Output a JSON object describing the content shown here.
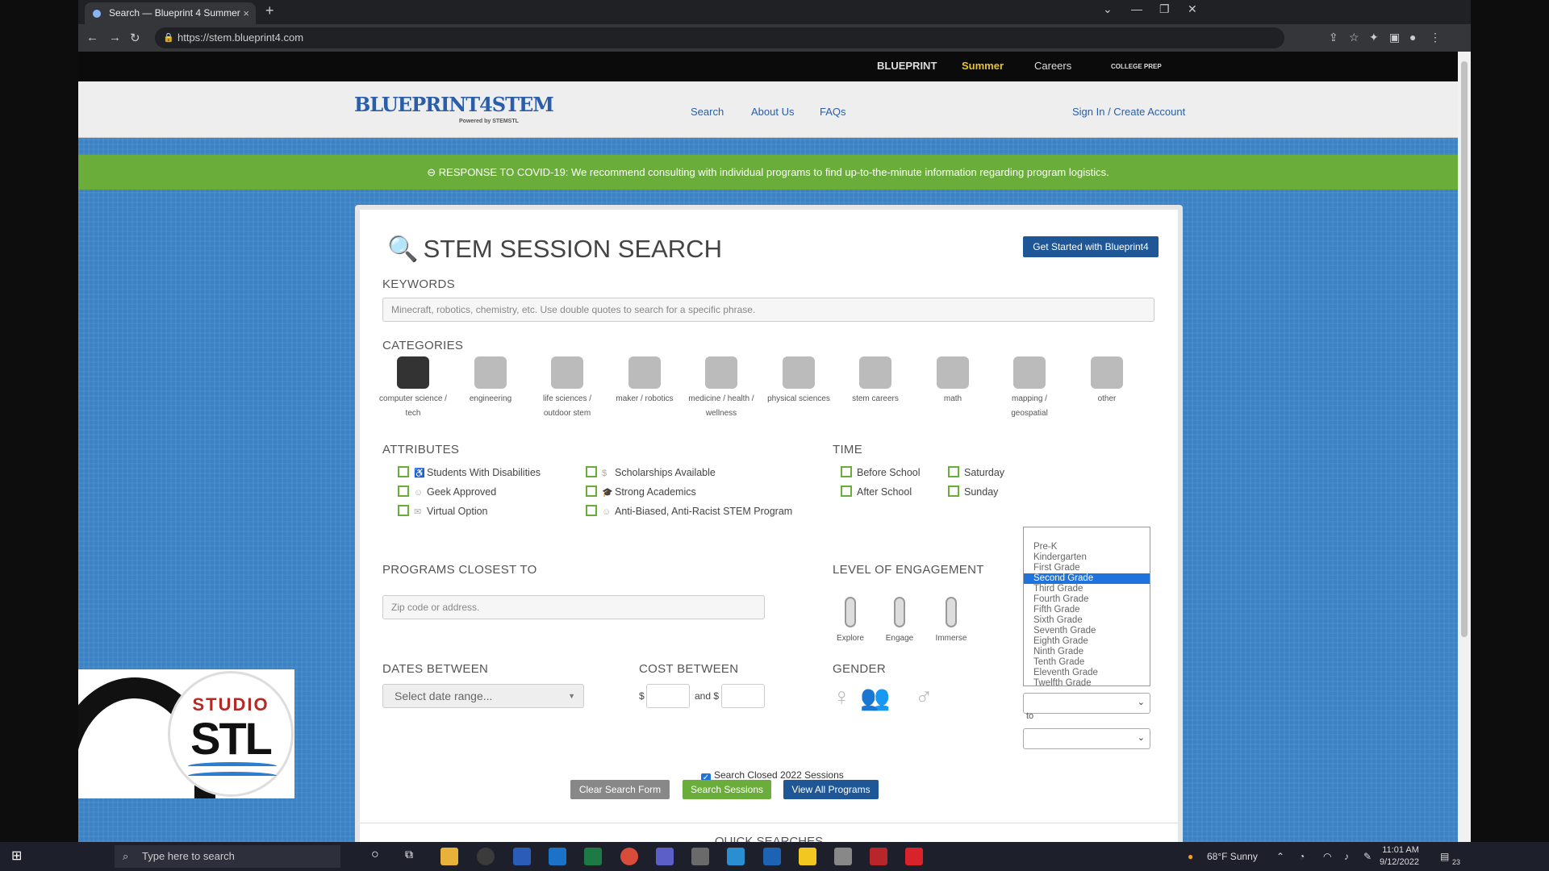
{
  "browser": {
    "tab_title": "Search — Blueprint 4 Summer",
    "url": "https://stem.blueprint4.com",
    "new_tab": "+",
    "close_tab": "×"
  },
  "topstrip": {
    "items": [
      "BLUEPRINT",
      "Summer",
      "Careers",
      "COLLEGE PREP"
    ]
  },
  "header": {
    "logo": "BLUEPRINT4STEM",
    "logo_sub": "Powered by STEMSTL",
    "nav": [
      "Search",
      "About Us",
      "FAQs"
    ],
    "signin": "Sign In / Create Account"
  },
  "banner": {
    "text": "RESPONSE TO COVID-19: We recommend consulting with individual programs to find up-to-the-minute information regarding program logistics."
  },
  "search": {
    "title": "STEM SESSION SEARCH",
    "get_started": "Get Started with Blueprint4",
    "keywords_label": "KEYWORDS",
    "keywords_placeholder": "Minecraft, robotics, chemistry, etc. Use double quotes to search for a specific phrase.",
    "categories_label": "CATEGORIES",
    "categories": [
      {
        "line1": "computer science /",
        "line2": "tech"
      },
      {
        "line1": "engineering",
        "line2": ""
      },
      {
        "line1": "life sciences /",
        "line2": "outdoor stem"
      },
      {
        "line1": "maker / robotics",
        "line2": ""
      },
      {
        "line1": "medicine / health /",
        "line2": "wellness"
      },
      {
        "line1": "physical sciences",
        "line2": ""
      },
      {
        "line1": "stem careers",
        "line2": ""
      },
      {
        "line1": "math",
        "line2": ""
      },
      {
        "line1": "mapping / geospatial",
        "line2": ""
      },
      {
        "line1": "other",
        "line2": ""
      }
    ],
    "attributes_label": "ATTRIBUTES",
    "attributes": [
      "Students With Disabilities",
      "Geek Approved",
      "Virtual Option",
      "Scholarships Available",
      "Strong Academics",
      "Anti-Biased, Anti-Racist STEM Program"
    ],
    "time_label": "TIME",
    "time": [
      "Before School",
      "After School",
      "Saturday",
      "Sunday"
    ],
    "closest_label": "PROGRAMS CLOSEST TO",
    "zip_placeholder": "Zip code or address.",
    "engagement_label": "LEVEL OF ENGAGEMENT",
    "engagement": [
      "Explore",
      "Engage",
      "Immerse"
    ],
    "dates_label": "DATES BETWEEN",
    "date_placeholder": "Select date range...",
    "cost_label": "COST BETWEEN",
    "cost_dollar": "$",
    "cost_and": "and $",
    "gender_label": "GENDER",
    "grade_to": "to",
    "grades": [
      "Pre-K",
      "Kindergarten",
      "First Grade",
      "Second Grade",
      "Third Grade",
      "Fourth Grade",
      "Fifth Grade",
      "Sixth Grade",
      "Seventh Grade",
      "Eighth Grade",
      "Ninth Grade",
      "Tenth Grade",
      "Eleventh Grade",
      "Twelfth Grade"
    ],
    "grade_selected": "Second Grade",
    "closed_label": "Search Closed 2022 Sessions",
    "clear_button": "Clear Search Form",
    "search_button": "Search Sessions",
    "view_all_button": "View All Programs",
    "quick_searches": "QUICK SEARCHES"
  },
  "overlay": {
    "line1": "STUDIO",
    "line2": "STL"
  },
  "taskbar": {
    "search_placeholder": "Type here to search",
    "weather": "68°F  Sunny",
    "time": "11:01 AM",
    "date": "9/12/2022",
    "notif_count": "23"
  },
  "colors": {
    "accent": "#1f5796",
    "banner": "#6bad3a",
    "page_bg": "#3c83c6",
    "selected_gender": "#b23aa6"
  }
}
